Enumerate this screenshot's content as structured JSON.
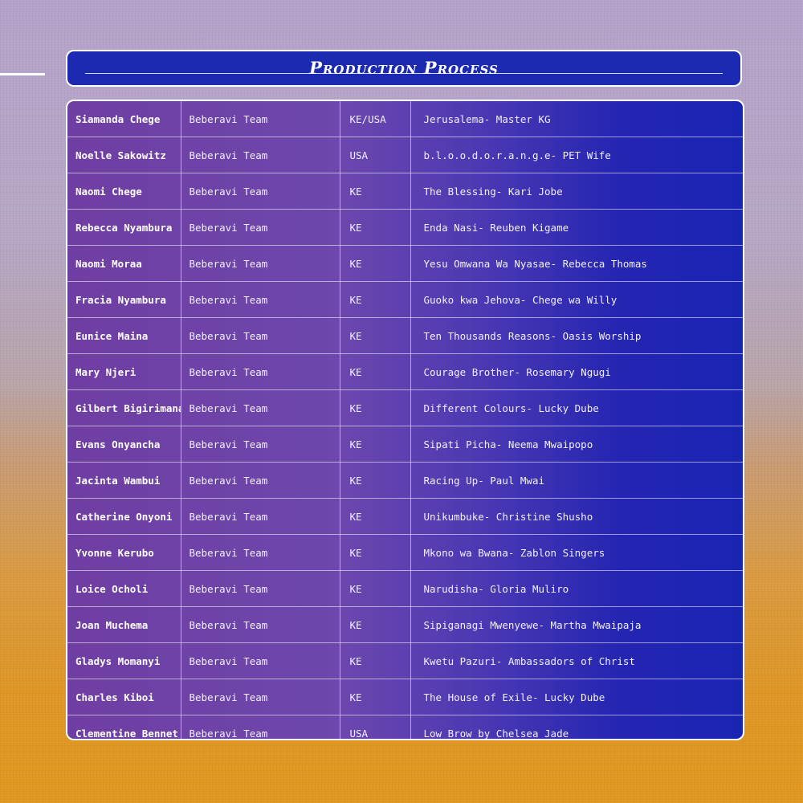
{
  "title": "Production Process",
  "rows": [
    {
      "name": "Siamanda Chege",
      "team": "Beberavi Team",
      "country": "KE/USA",
      "song": "Jerusalema- Master KG"
    },
    {
      "name": "Noelle Sakowitz",
      "team": "Beberavi Team",
      "country": "USA",
      "song": "b.l.o.o.d.o.r.a.n.g.e- PET Wife"
    },
    {
      "name": "Naomi Chege",
      "team": "Beberavi Team",
      "country": "KE",
      "song": "The Blessing- Kari Jobe"
    },
    {
      "name": "Rebecca Nyambura",
      "team": "Beberavi Team",
      "country": "KE",
      "song": "Enda Nasi- Reuben Kigame"
    },
    {
      "name": "Naomi Moraa",
      "team": "Beberavi Team",
      "country": "KE",
      "song": "Yesu Omwana Wa Nyasae- Rebecca Thomas"
    },
    {
      "name": "Fracia Nyambura",
      "team": "Beberavi Team",
      "country": "KE",
      "song": "Guoko kwa Jehova- Chege wa Willy"
    },
    {
      "name": "Eunice Maina",
      "team": "Beberavi Team",
      "country": "KE",
      "song": "Ten Thousands Reasons- Oasis Worship"
    },
    {
      "name": "Mary Njeri",
      "team": "Beberavi Team",
      "country": "KE",
      "song": "Courage Brother- Rosemary Ngugi"
    },
    {
      "name": "Gilbert Bigirimana",
      "team": "Beberavi Team",
      "country": "KE",
      "song": "Different Colours- Lucky Dube"
    },
    {
      "name": "Evans Onyancha",
      "team": "Beberavi Team",
      "country": "KE",
      "song": "Sipati Picha- Neema Mwaipopo"
    },
    {
      "name": "Jacinta Wambui",
      "team": "Beberavi Team",
      "country": "KE",
      "song": "Racing Up- Paul Mwai"
    },
    {
      "name": "Catherine Onyoni",
      "team": "Beberavi Team",
      "country": "KE",
      "song": "Unikumbuke- Christine Shusho"
    },
    {
      "name": "Yvonne Kerubo",
      "team": "Beberavi Team",
      "country": "KE",
      "song": "Mkono wa Bwana- Zablon Singers"
    },
    {
      "name": "Loice Ocholi",
      "team": "Beberavi Team",
      "country": "KE",
      "song": "Narudisha- Gloria Muliro"
    },
    {
      "name": "Joan Muchema",
      "team": "Beberavi Team",
      "country": "KE",
      "song": "Sipiganagi Mwenyewe- Martha Mwaipaja"
    },
    {
      "name": "Gladys Momanyi",
      "team": "Beberavi Team",
      "country": "KE",
      "song": "Kwetu Pazuri- Ambassadors of Christ"
    },
    {
      "name": "Charles Kiboi",
      "team": "Beberavi Team",
      "country": "KE",
      "song": "The House of Exile- Lucky Dube"
    },
    {
      "name": "Clementine Bennet",
      "team": "Beberavi Team",
      "country": "USA",
      "song": "Low Brow by Chelsea Jade"
    }
  ],
  "colors": {
    "title_bar": "#1c2ab2",
    "table_left": "#6f3ea2",
    "table_right": "#1a24b3",
    "background_top": "#b3a2c9",
    "background_bottom": "#e0961e"
  }
}
